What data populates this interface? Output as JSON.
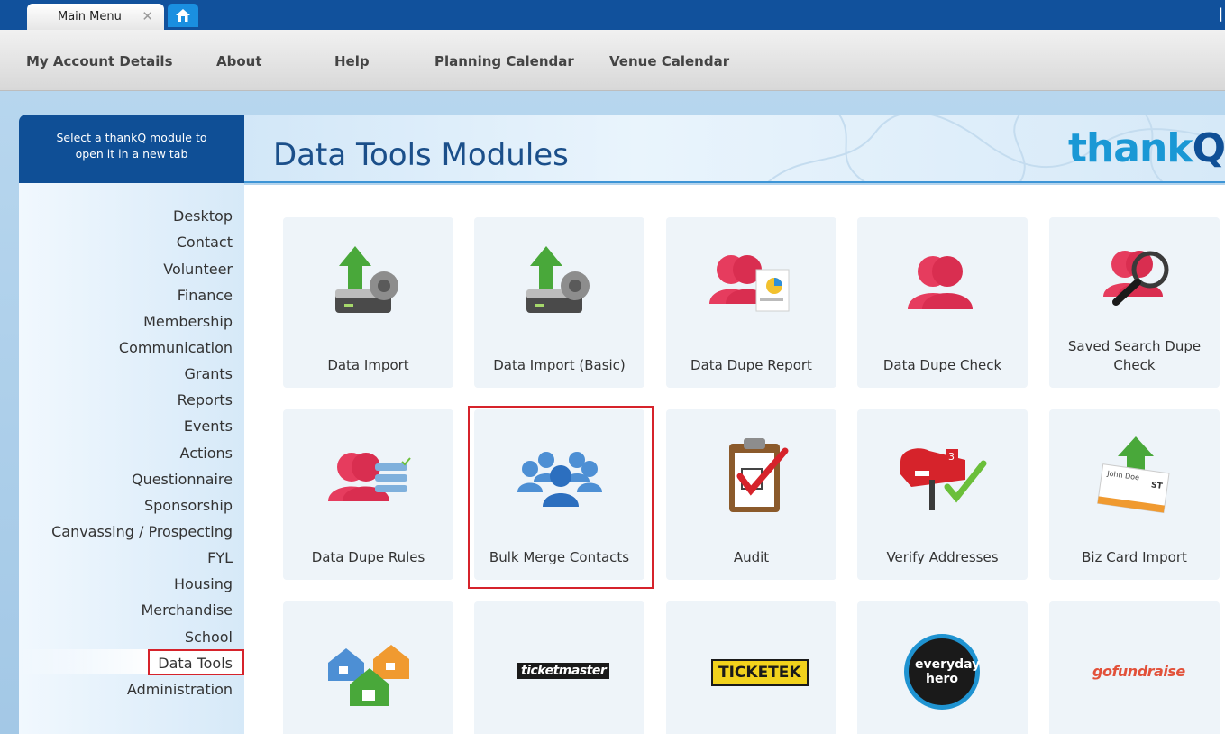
{
  "tabs": {
    "main_label": "Main Menu",
    "close_glyph": "✕",
    "home_icon": "home-icon"
  },
  "nav": {
    "items": [
      "My Account Details",
      "About",
      "Help",
      "Planning Calendar",
      "Venue Calendar"
    ]
  },
  "sidebar": {
    "header_line1": "Select a thankQ module to",
    "header_line2": "open it in a new tab",
    "items": [
      "Desktop",
      "Contact",
      "Volunteer",
      "Finance",
      "Membership",
      "Communication",
      "Grants",
      "Reports",
      "Events",
      "Actions",
      "Questionnaire",
      "Sponsorship",
      "Canvassing / Prospecting",
      "FYL",
      "Housing",
      "Merchandise",
      "School",
      "Data Tools",
      "Administration"
    ],
    "active": "Data Tools"
  },
  "main": {
    "title": "Data Tools Modules",
    "logo_text": "thank",
    "logo_q": "Q"
  },
  "tiles": {
    "row1": [
      "Data Import",
      "Data Import (Basic)",
      "Data Dupe Report",
      "Data Dupe Check",
      "Saved Search Dupe Check"
    ],
    "row2": [
      "Data Dupe Rules",
      "Bulk Merge Contacts",
      "Audit",
      "Verify Addresses",
      "Biz Card Import"
    ],
    "row3_logos": [
      "ticketmaster",
      "TICKETEK",
      "everyday hero",
      "gofundraise"
    ],
    "card_name": "John Doe",
    "card_initials": "ST",
    "mailbox_number": "3"
  },
  "colors": {
    "accent": "#11519c",
    "highlight": "#d6232b",
    "title": "#1b4f8a",
    "logo": "#1a98d5"
  }
}
